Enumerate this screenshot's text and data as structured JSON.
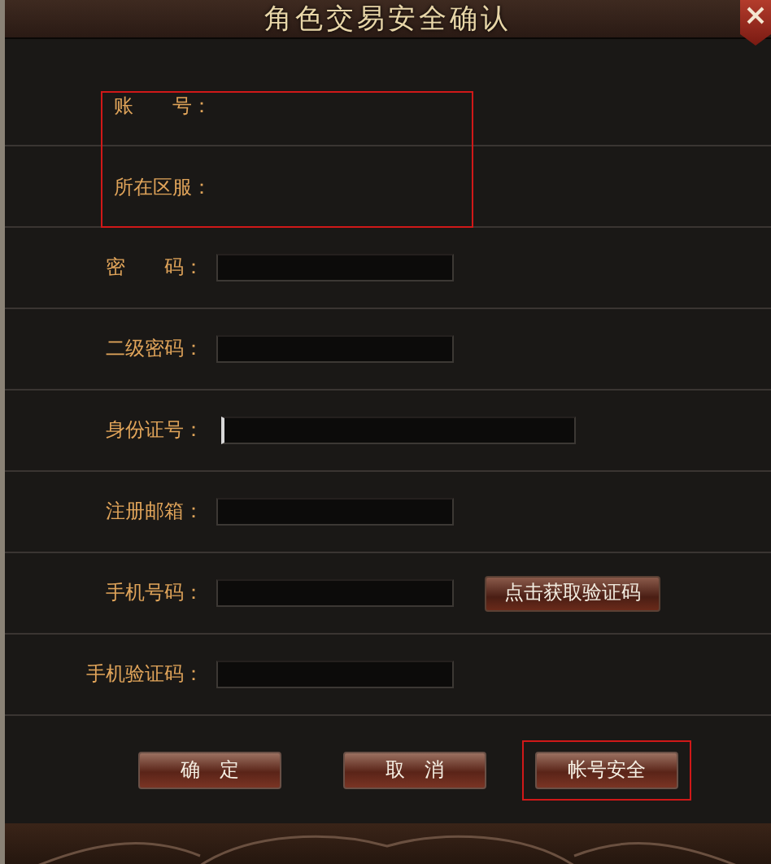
{
  "window": {
    "title": "角色交易安全确认"
  },
  "account_group": {
    "highlighted": true,
    "rows": [
      {
        "label": "账　　号："
      },
      {
        "label": "所在区服："
      }
    ]
  },
  "fields": [
    {
      "kind": "input",
      "label": "密　　码：",
      "focused": false
    },
    {
      "kind": "input",
      "label": "二级密码：",
      "focused": false
    },
    {
      "kind": "long-input",
      "label": "身份证号：",
      "focused": true
    },
    {
      "kind": "input",
      "label": "注册邮箱：",
      "focused": false
    },
    {
      "kind": "input-with-button",
      "label": "手机号码：",
      "focused": false,
      "button": "点击获取验证码"
    },
    {
      "kind": "input",
      "label": "手机验证码：",
      "focused": false
    }
  ],
  "buttons": [
    {
      "label": "确　定",
      "highlighted": false
    },
    {
      "label": "取　消",
      "highlighted": false
    },
    {
      "label": "帐号安全",
      "highlighted": true
    }
  ]
}
